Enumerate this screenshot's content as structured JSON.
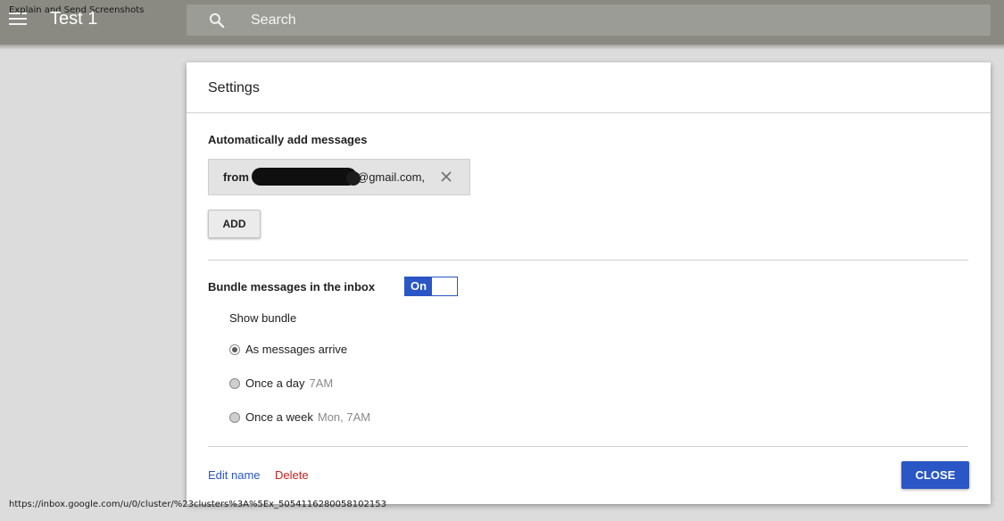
{
  "app": {
    "caption": "Explain and Send Screenshots",
    "title": "Test 1",
    "status_url": "https://inbox.google.com/u/0/cluster/%23clusters%3A%5Ex_5054116280058102153"
  },
  "search": {
    "placeholder": "Search"
  },
  "settings": {
    "title": "Settings",
    "auto_add_label": "Automatically add messages",
    "rule_chip": {
      "prefix": "from",
      "email_suffix": "@gmail.com,"
    },
    "add_label": "ADD",
    "bundle_label": "Bundle messages in the inbox",
    "toggle_state": "On",
    "show_bundle_label": "Show bundle",
    "options": [
      {
        "label": "As messages arrive",
        "sub": "",
        "selected": true
      },
      {
        "label": "Once a day",
        "sub": "7AM",
        "selected": false
      },
      {
        "label": "Once a week",
        "sub": "Mon, 7AM",
        "selected": false
      }
    ],
    "edit_name_label": "Edit name",
    "delete_label": "Delete",
    "close_label": "CLOSE"
  },
  "colors": {
    "topbar": "#8a8a82",
    "accent": "#2a56c6",
    "danger": "#c5221f",
    "backdrop": "#dcdcdc"
  },
  "icons": {
    "menu": "menu-icon",
    "search": "search-icon",
    "chip_remove": "close-icon"
  }
}
